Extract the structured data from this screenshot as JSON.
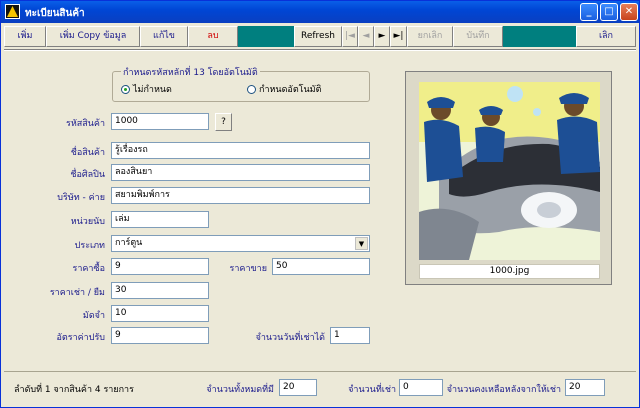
{
  "window": {
    "title": "ทะเบียนสินค้า"
  },
  "toolbar": {
    "add": "เพิ่ม",
    "add_copy": "เพิ่ม Copy ข้อมูล",
    "edit": "แก้ไข",
    "delete": "ลบ",
    "refresh": "Refresh",
    "first": "|◄",
    "prev": "◄",
    "next": "►",
    "last": "►|",
    "cancel": "ยกเลิก",
    "save": "บันทึก",
    "exit": "เลิก"
  },
  "group": {
    "title": "กำหนดรหัสหลักที่ 13 โดยอัตโนมัติ",
    "option_no": "ไม่กำหนด",
    "option_auto": "กำหนดอัตโนมัติ",
    "selected": "ไม่กำหนด"
  },
  "form": {
    "code_label": "รหัสสินค้า",
    "code": "1000",
    "lookup": "?",
    "name_label": "ชื่อสินค้า",
    "name": "รู้เรื่องรถ",
    "artist_label": "ชื่อศิลปิน",
    "artist": "ลองสินยา",
    "company_label": "บริษัท - ค่าย",
    "company": "สยามพิมพ์การ",
    "unit_label": "หน่วยนับ",
    "unit": "เล่ม",
    "type_label": "ประเภท",
    "type": "การ์ตูน",
    "cost_label": "ราคาซื้อ",
    "cost": "9",
    "price_label": "ราคาขาย",
    "price": "50",
    "rent_label": "ราคาเช่า / ยืม",
    "rent": "30",
    "deposit_label": "มัดจำ",
    "deposit": "10",
    "fine_label": "อัตราค่าปรับ",
    "fine": "9",
    "days_label": "จำนวนวันที่เช่าได้",
    "days": "1"
  },
  "photo": {
    "caption": "1000.jpg"
  },
  "status": {
    "record": "ลำดับที่  1 จากสินค้า 4 รายการ",
    "total_label": "จำนวนทั้งหมดที่มี",
    "total": "20",
    "rented_label": "จำนวนที่เช่า",
    "rented": "0",
    "remaining_label": "จำนวนคงเหลือหลังจากให้เช่า",
    "remaining": "20"
  }
}
